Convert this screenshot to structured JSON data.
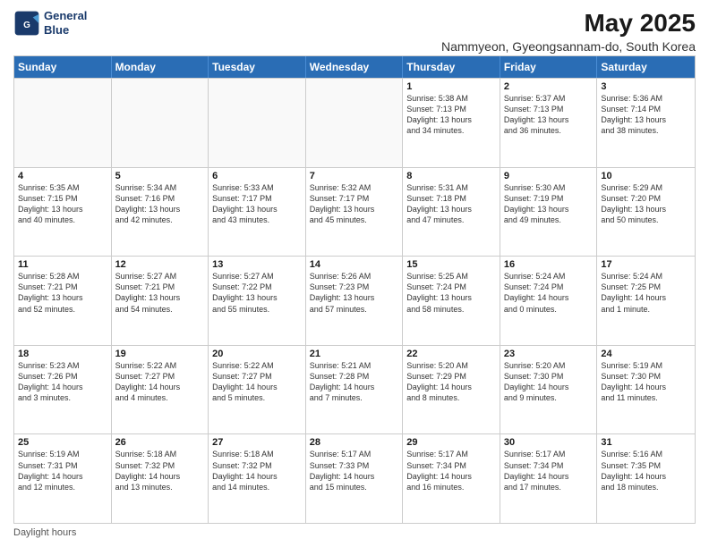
{
  "logo": {
    "line1": "General",
    "line2": "Blue"
  },
  "title": "May 2025",
  "subtitle": "Nammyeon, Gyeongsannam-do, South Korea",
  "weekdays": [
    "Sunday",
    "Monday",
    "Tuesday",
    "Wednesday",
    "Thursday",
    "Friday",
    "Saturday"
  ],
  "footer": "Daylight hours",
  "weeks": [
    [
      {
        "day": "",
        "info": ""
      },
      {
        "day": "",
        "info": ""
      },
      {
        "day": "",
        "info": ""
      },
      {
        "day": "",
        "info": ""
      },
      {
        "day": "1",
        "info": "Sunrise: 5:38 AM\nSunset: 7:13 PM\nDaylight: 13 hours\nand 34 minutes."
      },
      {
        "day": "2",
        "info": "Sunrise: 5:37 AM\nSunset: 7:13 PM\nDaylight: 13 hours\nand 36 minutes."
      },
      {
        "day": "3",
        "info": "Sunrise: 5:36 AM\nSunset: 7:14 PM\nDaylight: 13 hours\nand 38 minutes."
      }
    ],
    [
      {
        "day": "4",
        "info": "Sunrise: 5:35 AM\nSunset: 7:15 PM\nDaylight: 13 hours\nand 40 minutes."
      },
      {
        "day": "5",
        "info": "Sunrise: 5:34 AM\nSunset: 7:16 PM\nDaylight: 13 hours\nand 42 minutes."
      },
      {
        "day": "6",
        "info": "Sunrise: 5:33 AM\nSunset: 7:17 PM\nDaylight: 13 hours\nand 43 minutes."
      },
      {
        "day": "7",
        "info": "Sunrise: 5:32 AM\nSunset: 7:17 PM\nDaylight: 13 hours\nand 45 minutes."
      },
      {
        "day": "8",
        "info": "Sunrise: 5:31 AM\nSunset: 7:18 PM\nDaylight: 13 hours\nand 47 minutes."
      },
      {
        "day": "9",
        "info": "Sunrise: 5:30 AM\nSunset: 7:19 PM\nDaylight: 13 hours\nand 49 minutes."
      },
      {
        "day": "10",
        "info": "Sunrise: 5:29 AM\nSunset: 7:20 PM\nDaylight: 13 hours\nand 50 minutes."
      }
    ],
    [
      {
        "day": "11",
        "info": "Sunrise: 5:28 AM\nSunset: 7:21 PM\nDaylight: 13 hours\nand 52 minutes."
      },
      {
        "day": "12",
        "info": "Sunrise: 5:27 AM\nSunset: 7:21 PM\nDaylight: 13 hours\nand 54 minutes."
      },
      {
        "day": "13",
        "info": "Sunrise: 5:27 AM\nSunset: 7:22 PM\nDaylight: 13 hours\nand 55 minutes."
      },
      {
        "day": "14",
        "info": "Sunrise: 5:26 AM\nSunset: 7:23 PM\nDaylight: 13 hours\nand 57 minutes."
      },
      {
        "day": "15",
        "info": "Sunrise: 5:25 AM\nSunset: 7:24 PM\nDaylight: 13 hours\nand 58 minutes."
      },
      {
        "day": "16",
        "info": "Sunrise: 5:24 AM\nSunset: 7:24 PM\nDaylight: 14 hours\nand 0 minutes."
      },
      {
        "day": "17",
        "info": "Sunrise: 5:24 AM\nSunset: 7:25 PM\nDaylight: 14 hours\nand 1 minute."
      }
    ],
    [
      {
        "day": "18",
        "info": "Sunrise: 5:23 AM\nSunset: 7:26 PM\nDaylight: 14 hours\nand 3 minutes."
      },
      {
        "day": "19",
        "info": "Sunrise: 5:22 AM\nSunset: 7:27 PM\nDaylight: 14 hours\nand 4 minutes."
      },
      {
        "day": "20",
        "info": "Sunrise: 5:22 AM\nSunset: 7:27 PM\nDaylight: 14 hours\nand 5 minutes."
      },
      {
        "day": "21",
        "info": "Sunrise: 5:21 AM\nSunset: 7:28 PM\nDaylight: 14 hours\nand 7 minutes."
      },
      {
        "day": "22",
        "info": "Sunrise: 5:20 AM\nSunset: 7:29 PM\nDaylight: 14 hours\nand 8 minutes."
      },
      {
        "day": "23",
        "info": "Sunrise: 5:20 AM\nSunset: 7:30 PM\nDaylight: 14 hours\nand 9 minutes."
      },
      {
        "day": "24",
        "info": "Sunrise: 5:19 AM\nSunset: 7:30 PM\nDaylight: 14 hours\nand 11 minutes."
      }
    ],
    [
      {
        "day": "25",
        "info": "Sunrise: 5:19 AM\nSunset: 7:31 PM\nDaylight: 14 hours\nand 12 minutes."
      },
      {
        "day": "26",
        "info": "Sunrise: 5:18 AM\nSunset: 7:32 PM\nDaylight: 14 hours\nand 13 minutes."
      },
      {
        "day": "27",
        "info": "Sunrise: 5:18 AM\nSunset: 7:32 PM\nDaylight: 14 hours\nand 14 minutes."
      },
      {
        "day": "28",
        "info": "Sunrise: 5:17 AM\nSunset: 7:33 PM\nDaylight: 14 hours\nand 15 minutes."
      },
      {
        "day": "29",
        "info": "Sunrise: 5:17 AM\nSunset: 7:34 PM\nDaylight: 14 hours\nand 16 minutes."
      },
      {
        "day": "30",
        "info": "Sunrise: 5:17 AM\nSunset: 7:34 PM\nDaylight: 14 hours\nand 17 minutes."
      },
      {
        "day": "31",
        "info": "Sunrise: 5:16 AM\nSunset: 7:35 PM\nDaylight: 14 hours\nand 18 minutes."
      }
    ]
  ]
}
